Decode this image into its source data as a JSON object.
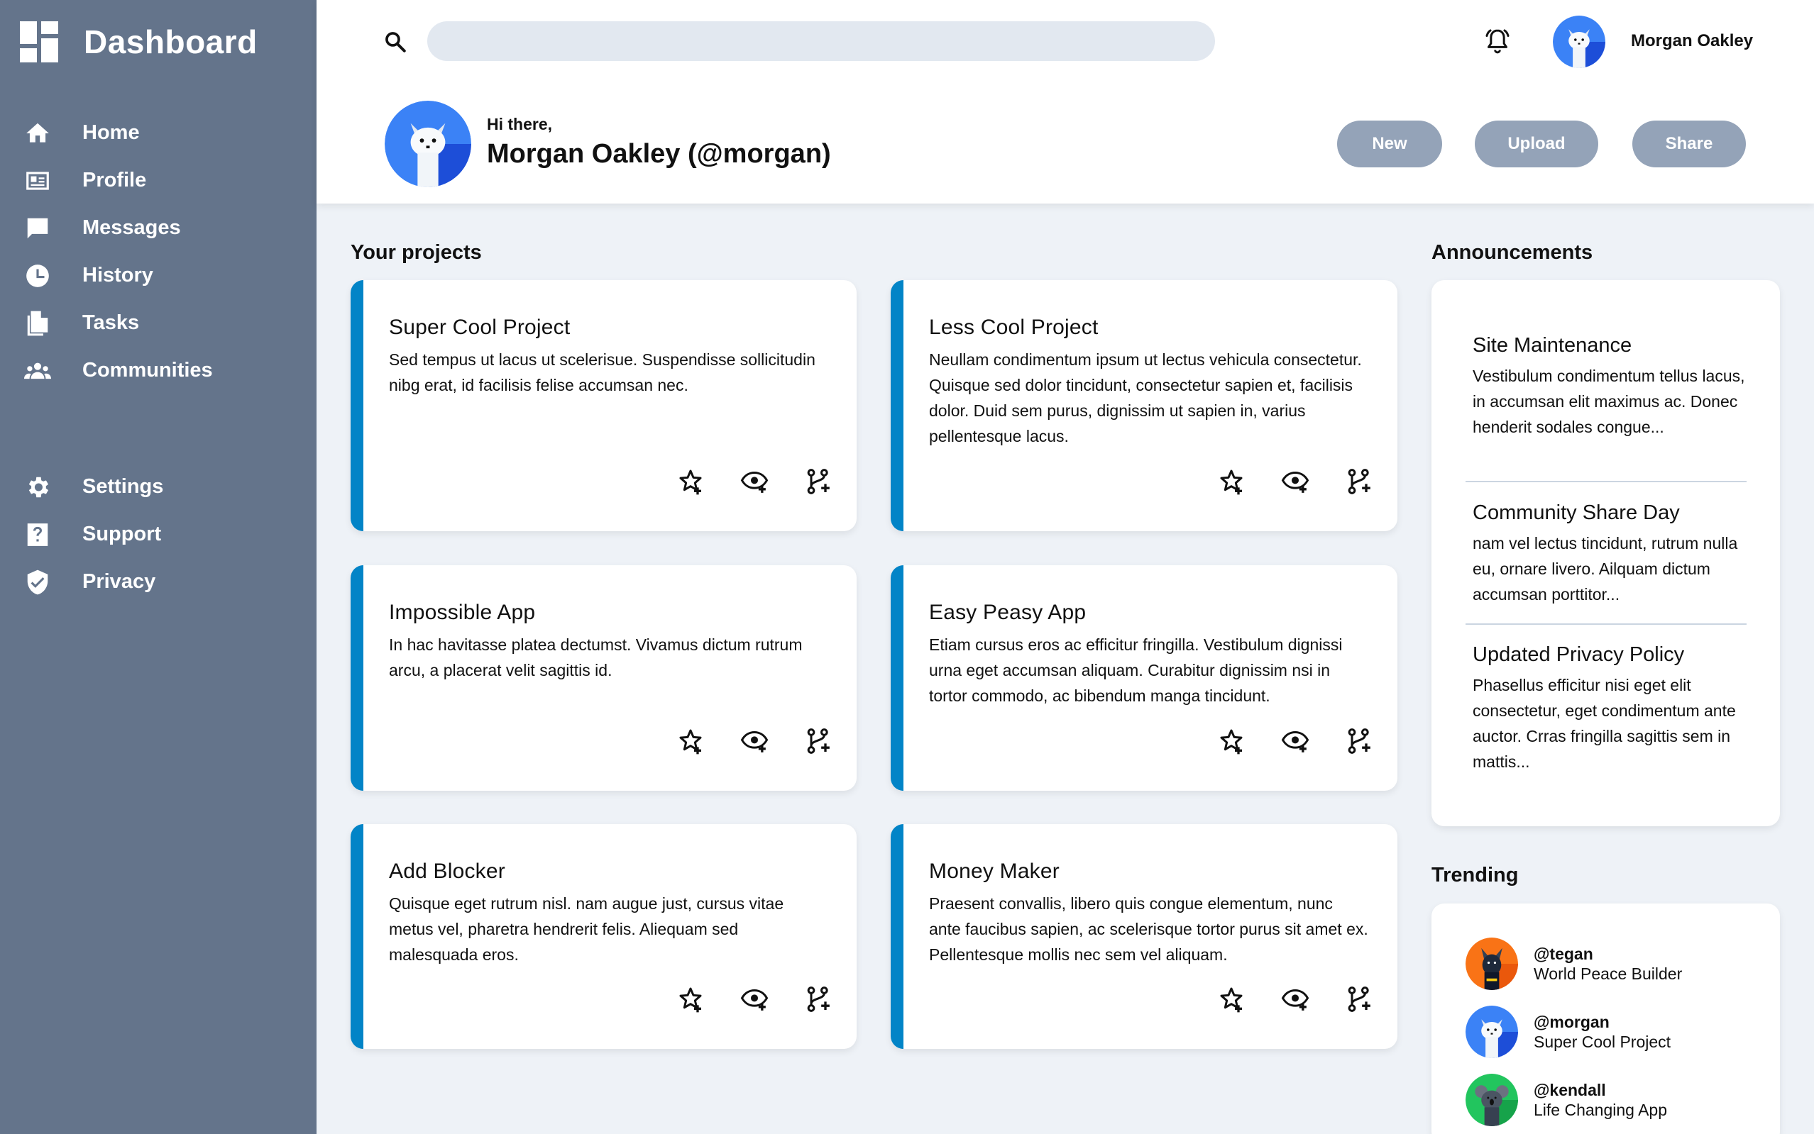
{
  "sidebar": {
    "title": "Dashboard",
    "items": [
      {
        "label": "Home",
        "icon": "home-icon"
      },
      {
        "label": "Profile",
        "icon": "profile-card-icon"
      },
      {
        "label": "Messages",
        "icon": "chat-bubble-icon"
      },
      {
        "label": "History",
        "icon": "clock-icon"
      },
      {
        "label": "Tasks",
        "icon": "document-icon"
      },
      {
        "label": "Communities",
        "icon": "people-icon"
      }
    ],
    "secondary_items": [
      {
        "label": "Settings",
        "icon": "gear-icon"
      },
      {
        "label": "Support",
        "icon": "help-icon"
      },
      {
        "label": "Privacy",
        "icon": "shield-check-icon"
      }
    ]
  },
  "header": {
    "search_placeholder": "",
    "username": "Morgan Oakley",
    "greeting": "Hi there,",
    "display_name": "Morgan Oakley (@morgan)",
    "buttons": {
      "new": "New",
      "upload": "Upload",
      "share": "Share"
    }
  },
  "projects": {
    "title": "Your projects",
    "items": [
      {
        "title": "Super Cool Project",
        "description": "Sed tempus ut lacus ut scelerisue. Suspendisse sollicitudin nibg erat, id facilisis felise accumsan nec."
      },
      {
        "title": "Less Cool Project",
        "description": "Neullam condimentum ipsum ut lectus vehicula consectetur. Quisque sed dolor tincidunt, consectetur sapien et, facilisis dolor. Duid sem purus, dignissim ut sapien in, varius pellentesque lacus."
      },
      {
        "title": "Impossible App",
        "description": "In hac havitasse platea dectumst. Vivamus dictum rutrum arcu, a placerat velit sagittis id."
      },
      {
        "title": "Easy Peasy App",
        "description": "Etiam cursus eros ac efficitur fringilla. Vestibulum dignissi urna eget accumsan aliquam. Curabitur dignissim nsi in tortor commodo, ac bibendum manga tincidunt."
      },
      {
        "title": "Add Blocker",
        "description": "Quisque eget rutrum nisl. nam augue just, cursus vitae metus vel, pharetra hendrerit felis. Aliequam sed malesquada eros."
      },
      {
        "title": "Money Maker",
        "description": "Praesent convallis, libero quis congue elementum, nunc ante faucibus sapien, ac scelerisque tortor purus sit amet ex. Pellentesque mollis nec sem vel aliquam."
      }
    ]
  },
  "announcements": {
    "title": "Announcements",
    "items": [
      {
        "title": "Site Maintenance",
        "body": "Vestibulum condimentum tellus lacus, in accumsan elit maximus ac. Donec henderit sodales congue..."
      },
      {
        "title": "Community Share Day",
        "body": "nam vel lectus tincidunt, rutrum nulla eu, ornare livero. Ailquam dictum accumsan porttitor..."
      },
      {
        "title": "Updated Privacy Policy",
        "body": "Phasellus efficitur nisi eget elit consectetur, eget condimentum ante auctor. Crras fringilla sagittis sem in mattis..."
      }
    ]
  },
  "trending": {
    "title": "Trending",
    "items": [
      {
        "handle": "@tegan",
        "project": "World Peace Builder",
        "avatar": "dog-avatar",
        "color": "#f97316"
      },
      {
        "handle": "@morgan",
        "project": "Super Cool Project",
        "avatar": "cat-avatar",
        "color": "#3b82f6"
      },
      {
        "handle": "@kendall",
        "project": "Life Changing App",
        "avatar": "koala-avatar",
        "color": "#22c55e"
      }
    ]
  },
  "colors": {
    "sidebar": "#64748b",
    "accent": "#0284c7",
    "button": "#94a3b8",
    "search": "#e2e8f0"
  }
}
